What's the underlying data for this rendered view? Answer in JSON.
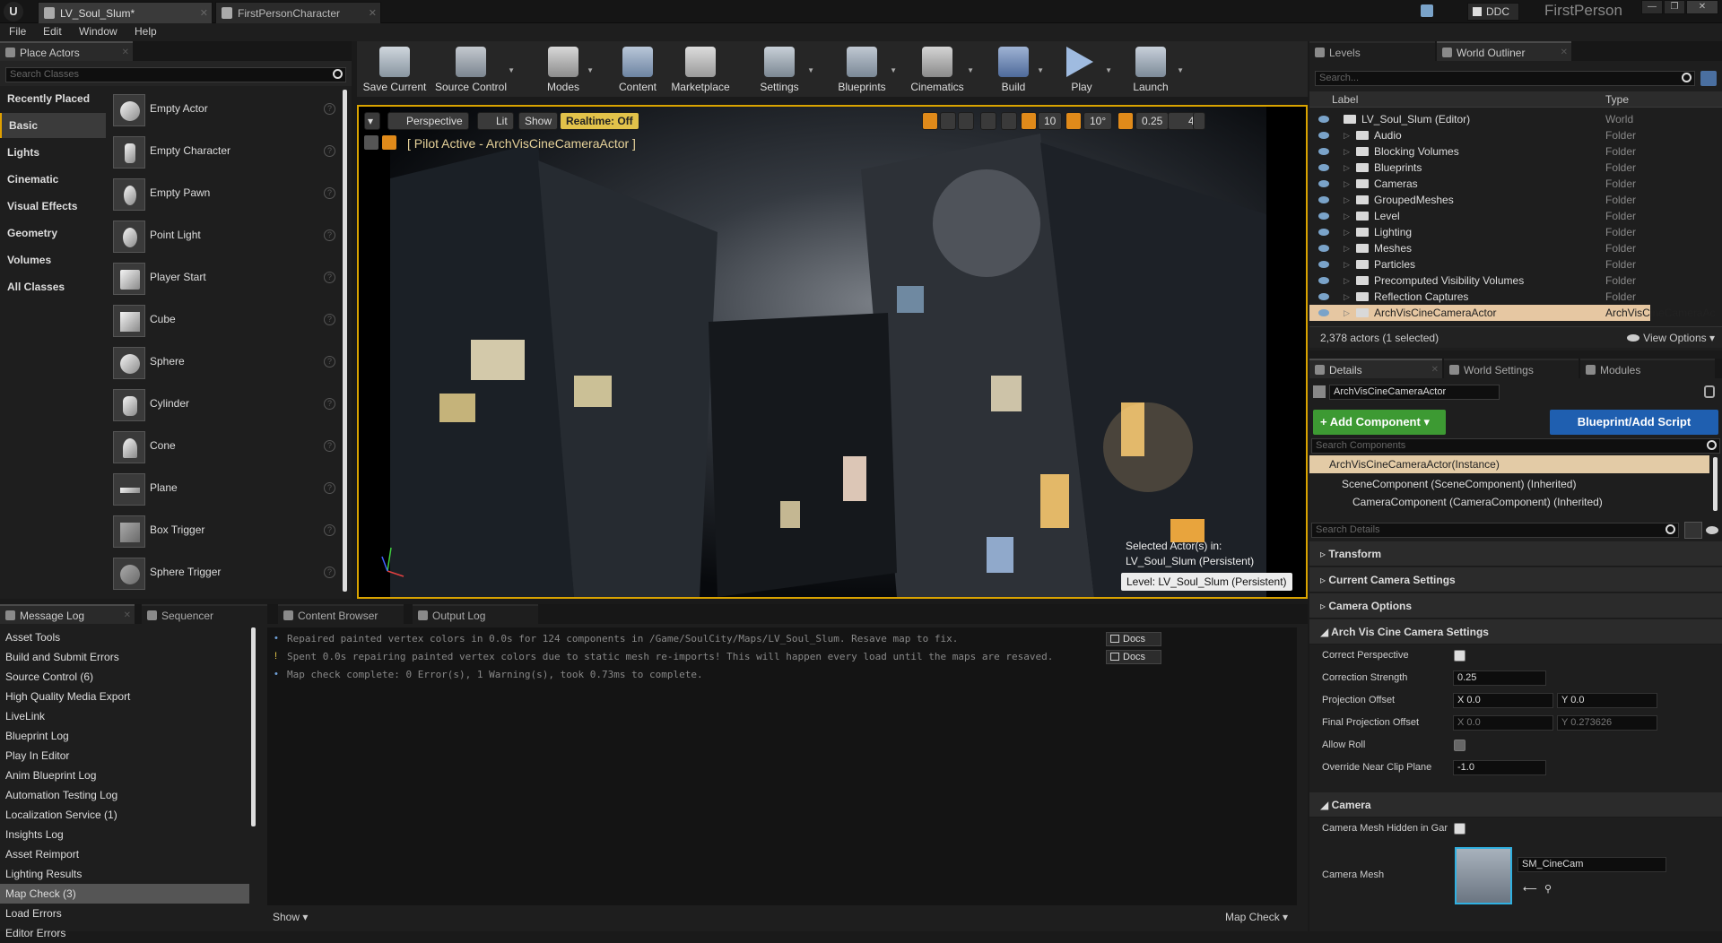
{
  "title_bar": {
    "tabs": [
      "LV_Soul_Slum*",
      "FirstPersonCharacter"
    ],
    "ddc_label": "DDC",
    "project": "FirstPerson"
  },
  "menu": [
    "File",
    "Edit",
    "Window",
    "Help"
  ],
  "place_actors": {
    "tab": "Place Actors",
    "search_placeholder": "Search Classes",
    "categories": [
      "Recently Placed",
      "Basic",
      "Lights",
      "Cinematic",
      "Visual Effects",
      "Geometry",
      "Volumes",
      "All Classes"
    ],
    "selected_category": "Basic",
    "actors": [
      "Empty Actor",
      "Empty Character",
      "Empty Pawn",
      "Point Light",
      "Player Start",
      "Cube",
      "Sphere",
      "Cylinder",
      "Cone",
      "Plane",
      "Box Trigger",
      "Sphere Trigger"
    ],
    "help_glyph": "?"
  },
  "toolbar": {
    "buttons": [
      "Save Current",
      "Source Control",
      "Modes",
      "Content",
      "Marketplace",
      "Settings",
      "Blueprints",
      "Cinematics",
      "Build",
      "Play",
      "Launch"
    ]
  },
  "viewport": {
    "perspective": "Perspective",
    "lit": "Lit",
    "show": "Show",
    "realtime": "Realtime: Off",
    "pilot": "[ Pilot Active - ArchVisCineCameraActor ]",
    "grid_snap": "10",
    "rot_snap": "10°",
    "scale_snap": "0.25",
    "cam_speed": "4",
    "selected_actors": "Selected Actor(s) in:",
    "selected_level": "LV_Soul_Slum (Persistent)",
    "level_badge": "Level:  LV_Soul_Slum (Persistent)"
  },
  "outliner": {
    "tabs": [
      "Levels",
      "World Outliner"
    ],
    "search_placeholder": "Search...",
    "col_label": "Label",
    "col_type": "Type",
    "rows": [
      {
        "label": "LV_Soul_Slum (Editor)",
        "type": "World"
      },
      {
        "label": "Audio",
        "type": "Folder"
      },
      {
        "label": "Blocking Volumes",
        "type": "Folder"
      },
      {
        "label": "Blueprints",
        "type": "Folder"
      },
      {
        "label": "Cameras",
        "type": "Folder"
      },
      {
        "label": "GroupedMeshes",
        "type": "Folder"
      },
      {
        "label": "Level",
        "type": "Folder"
      },
      {
        "label": "Lighting",
        "type": "Folder"
      },
      {
        "label": "Meshes",
        "type": "Folder"
      },
      {
        "label": "Particles",
        "type": "Folder"
      },
      {
        "label": "Precomputed Visibility Volumes",
        "type": "Folder"
      },
      {
        "label": "Reflection Captures",
        "type": "Folder"
      },
      {
        "label": "ArchVisCineCameraActor",
        "type": "ArchVisCineCameraAc"
      }
    ],
    "count": "2,378 actors (1 selected)",
    "view_options": "View Options"
  },
  "details": {
    "tabs": [
      "Details",
      "World Settings",
      "Modules"
    ],
    "name": "ArchVisCineCameraActor",
    "add_component": "+ Add Component",
    "blueprint": "Blueprint/Add Script",
    "search_components": "Search Components",
    "instance": "ArchVisCineCameraActor(Instance)",
    "components": [
      "SceneComponent (SceneComponent) (Inherited)",
      "CameraComponent (CameraComponent) (Inherited)"
    ],
    "search_details": "Search Details",
    "sections": [
      "Transform",
      "Current Camera Settings",
      "Camera Options",
      "Arch Vis Cine Camera Settings"
    ],
    "props": {
      "correct_perspective": "Correct Perspective",
      "correction_strength": "Correction Strength",
      "correction_strength_val": "0.25",
      "projection_offset": "Projection Offset",
      "proj_x": "X  0.0",
      "proj_y": "Y  0.0",
      "final_projection_offset": "Final Projection Offset",
      "final_x": "X  0.0",
      "final_y": "Y  0.273626",
      "allow_roll": "Allow Roll",
      "override_near": "Override Near Clip Plane",
      "override_near_val": "-1.0"
    },
    "camera_section": "Camera",
    "camera_mesh_hidden": "Camera Mesh Hidden in Gar",
    "camera_mesh": "Camera Mesh",
    "camera_mesh_val": "SM_CineCam"
  },
  "bottom": {
    "tabs": [
      "Message Log",
      "Sequencer",
      "Content Browser",
      "Output Log"
    ],
    "log_categories": [
      "Asset Tools",
      "Build and Submit Errors",
      "Source Control (6)",
      "High Quality Media Export",
      "LiveLink",
      "Blueprint Log",
      "Play In Editor",
      "Anim Blueprint Log",
      "Automation Testing Log",
      "Localization Service (1)",
      "Insights Log",
      "Asset Reimport",
      "Lighting Results",
      "Map Check (3)",
      "Load Errors",
      "Editor Errors"
    ],
    "selected": "Map Check (3)",
    "lines": [
      "Repaired painted vertex colors in 0.0s for 124 components in /Game/SoulCity/Maps/LV_Soul_Slum.  Resave map to fix.",
      "Spent 0.0s repairing painted vertex colors due to static mesh re-imports!  This will happen every load until the maps are resaved.",
      "Map check complete: 0 Error(s), 1 Warning(s), took 0.73ms to complete."
    ],
    "line_markers": [
      "•",
      "!",
      "•"
    ],
    "docs": "Docs",
    "show": "Show",
    "map_check": "Map Check"
  }
}
